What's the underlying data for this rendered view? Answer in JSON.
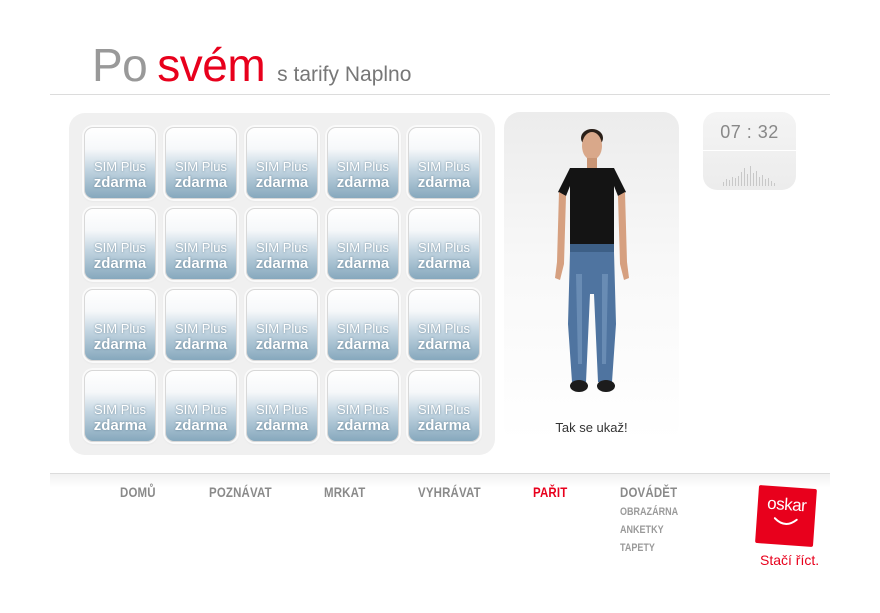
{
  "header": {
    "title_po": "Po",
    "title_svem": "svém",
    "title_sub": "s tarify Naplno"
  },
  "tiles": {
    "line1": "SIM Plus",
    "line2": "zdarma"
  },
  "person": {
    "caption": "Tak se ukaž!"
  },
  "clock": {
    "time": "07 : 32"
  },
  "nav": {
    "items": [
      {
        "label": "DOMŮ"
      },
      {
        "label": "POZNÁVAT"
      },
      {
        "label": "MRKAT"
      },
      {
        "label": "VYHRÁVAT"
      },
      {
        "label": "PAŘIT"
      },
      {
        "label": "DOVÁDĚT"
      }
    ],
    "active": "PAŘIT",
    "sub_items": [
      {
        "label": "OBRAZÁRNA"
      },
      {
        "label": "ANKETKY"
      },
      {
        "label": "TAPETY"
      }
    ]
  },
  "brand": {
    "logo_text": "oskar",
    "slogan": "Stačí říct.",
    "accent_color": "#e8001c"
  }
}
